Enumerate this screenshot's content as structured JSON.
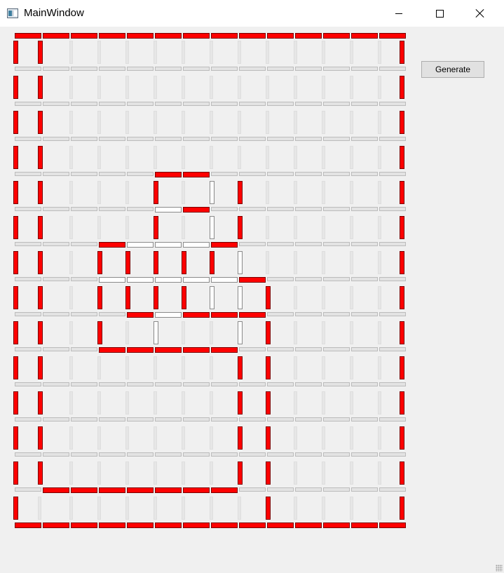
{
  "window": {
    "title": "MainWindow",
    "controls": [
      "minimize",
      "maximize",
      "close"
    ]
  },
  "toolbar": {
    "generate_label": "Generate"
  },
  "colors": {
    "wall": "#ff0000",
    "path": "#ffffff",
    "inactive": "#e3e3e3",
    "background": "#f0f0f0"
  },
  "maze": {
    "columns": 14,
    "rows": 14,
    "h_walls": [
      "RRRRRRRRRRRRRR",
      "GGGGGGGGGGGGGG",
      "GGGGGGGGGGGGGG",
      "GGGGGGGGGGGGGG",
      "GGGGGRRGGGGGGG",
      "GGGGGWRGGGGGGG",
      "GGGRWWWRGGGGGG",
      "GGGWWWWWRGGGGG",
      "GGGGRWRRRGGGGG",
      "GGGRRRRRGGGGGG",
      "GGGGGGGGGGGGGG",
      "GGGGGGGGGGGGGG",
      "GGGGGGGGGGGGGG",
      "GRRRRRRRGGGGGG",
      "RRRRRRRRRRRRRR"
    ],
    "v_walls": [
      "RRGGGGGGGGGGGGR",
      "RRGGGGGGGGGGGGR",
      "RRGGGGGGGGGGGGR",
      "RRGGGGGGGGGGGGR",
      "RRGGGRGWRGGGGGR",
      "RRGGGRGWRGGGGGR",
      "RRGRRRRRWGGGGGR",
      "RRGRRRRWWRGGGGR",
      "RRGRGWGGWRGGGGR",
      "RRGGGGGGRRGGGGR",
      "RRGGGGGGRRGGGGR",
      "RRGGGGGGRRGGGGR",
      "RRGGGGGGRRGGGGR",
      "RGGGGGGGGRGGGGR"
    ]
  }
}
